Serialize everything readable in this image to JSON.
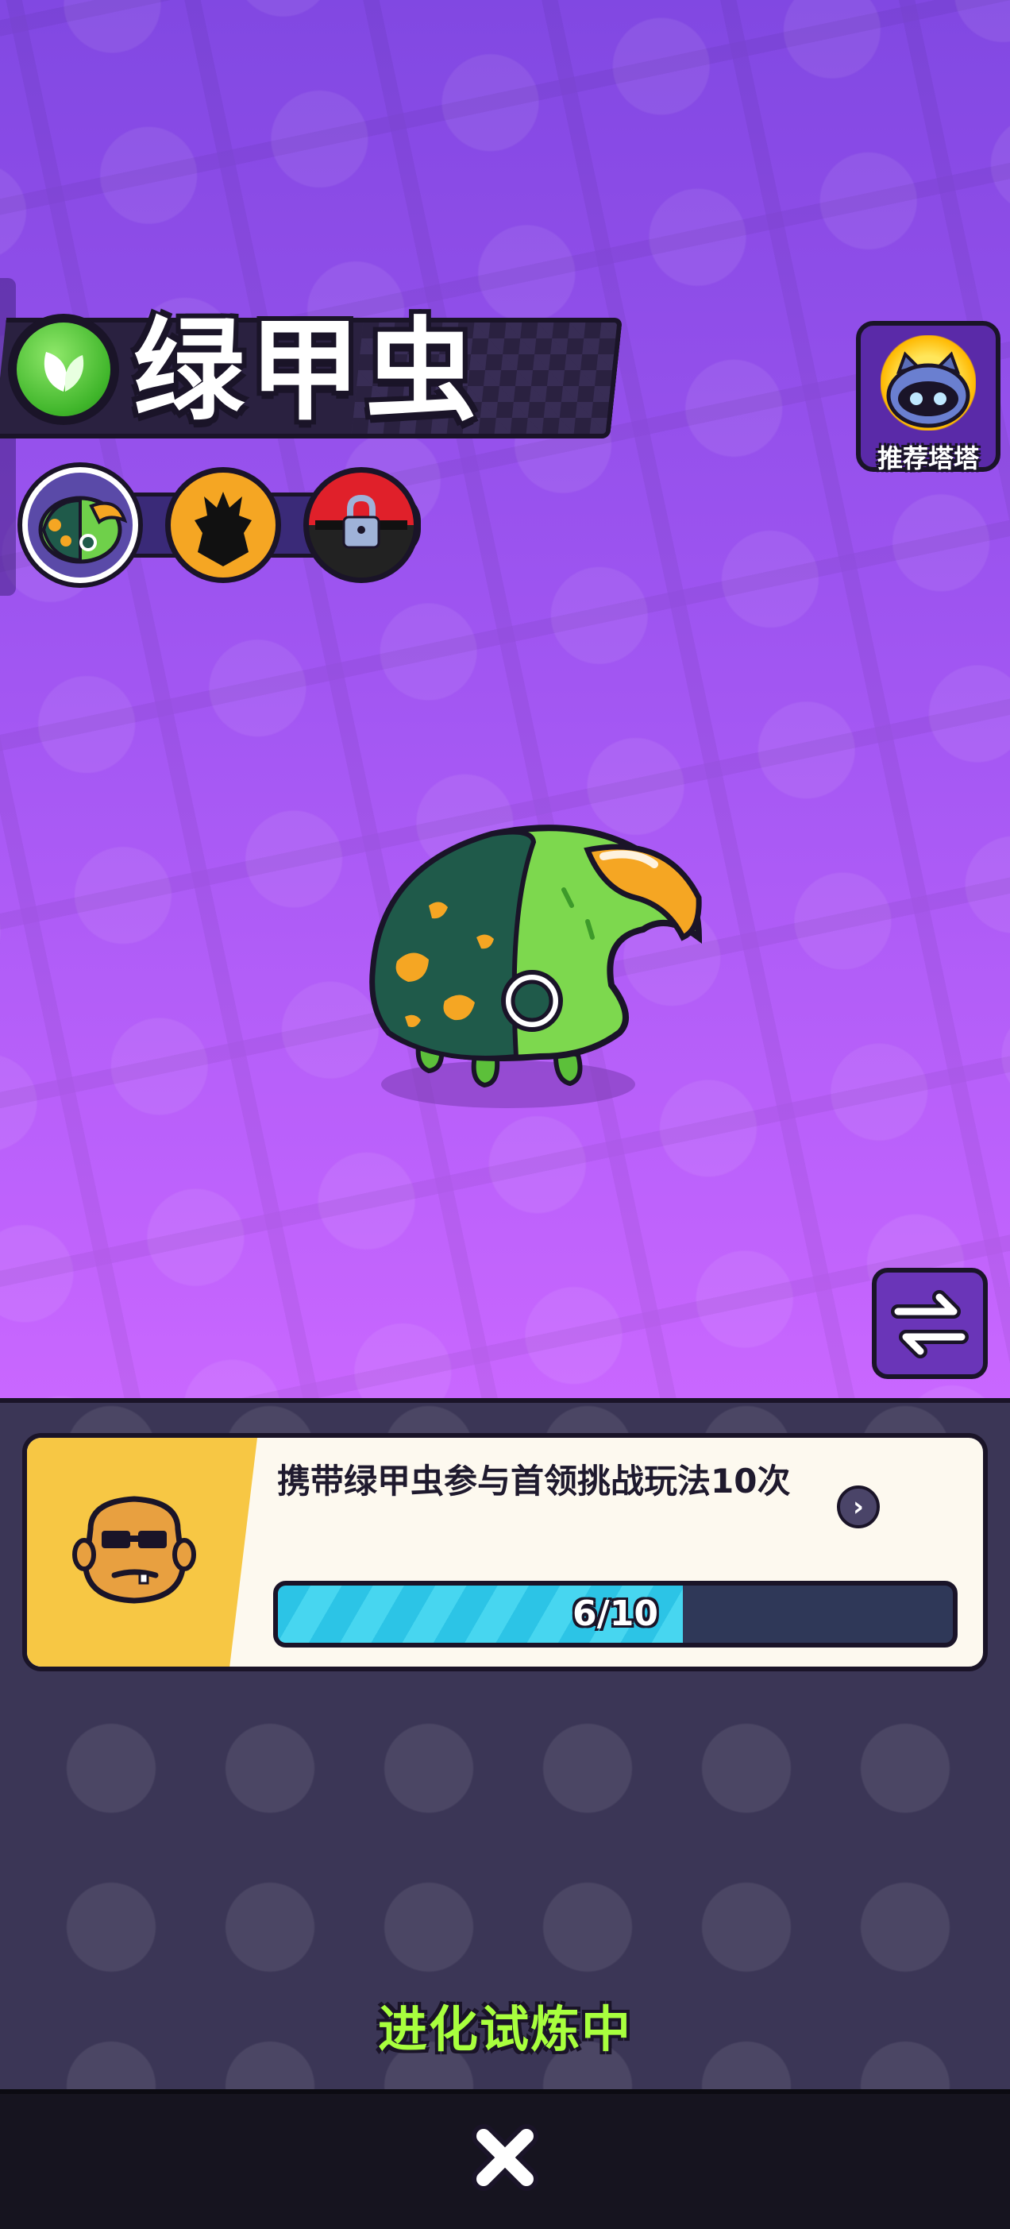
{
  "header": {
    "title": "绿甲虫",
    "element_icon": "leaf-icon",
    "element_color": "#3fb52a"
  },
  "evolution": {
    "stages": [
      {
        "icon": "green-beetle-icon",
        "state": "current"
      },
      {
        "icon": "beetle-silhouette-icon",
        "state": "unrevealed"
      },
      {
        "icon": "lock-icon",
        "state": "locked"
      }
    ]
  },
  "recommend": {
    "label": "推荐塔塔",
    "icon": "cat-robot-icon"
  },
  "swap": {
    "icon": "swap-arrows-icon"
  },
  "quest": {
    "description": "携带绿甲虫参与首领挑战玩法10次",
    "progress_current": 6,
    "progress_total": 10,
    "progress_text": "6/10",
    "icon": "boss-face-icon",
    "arrow_icon": "chevron-right-icon"
  },
  "status": {
    "text": "进化试炼中"
  },
  "close": {
    "icon": "close-icon"
  },
  "colors": {
    "accent_green": "#a8ff3e",
    "progress_fill": "#47d6f0",
    "purple_bg": "#9a4df0",
    "panel_bg": "#3b3656"
  }
}
